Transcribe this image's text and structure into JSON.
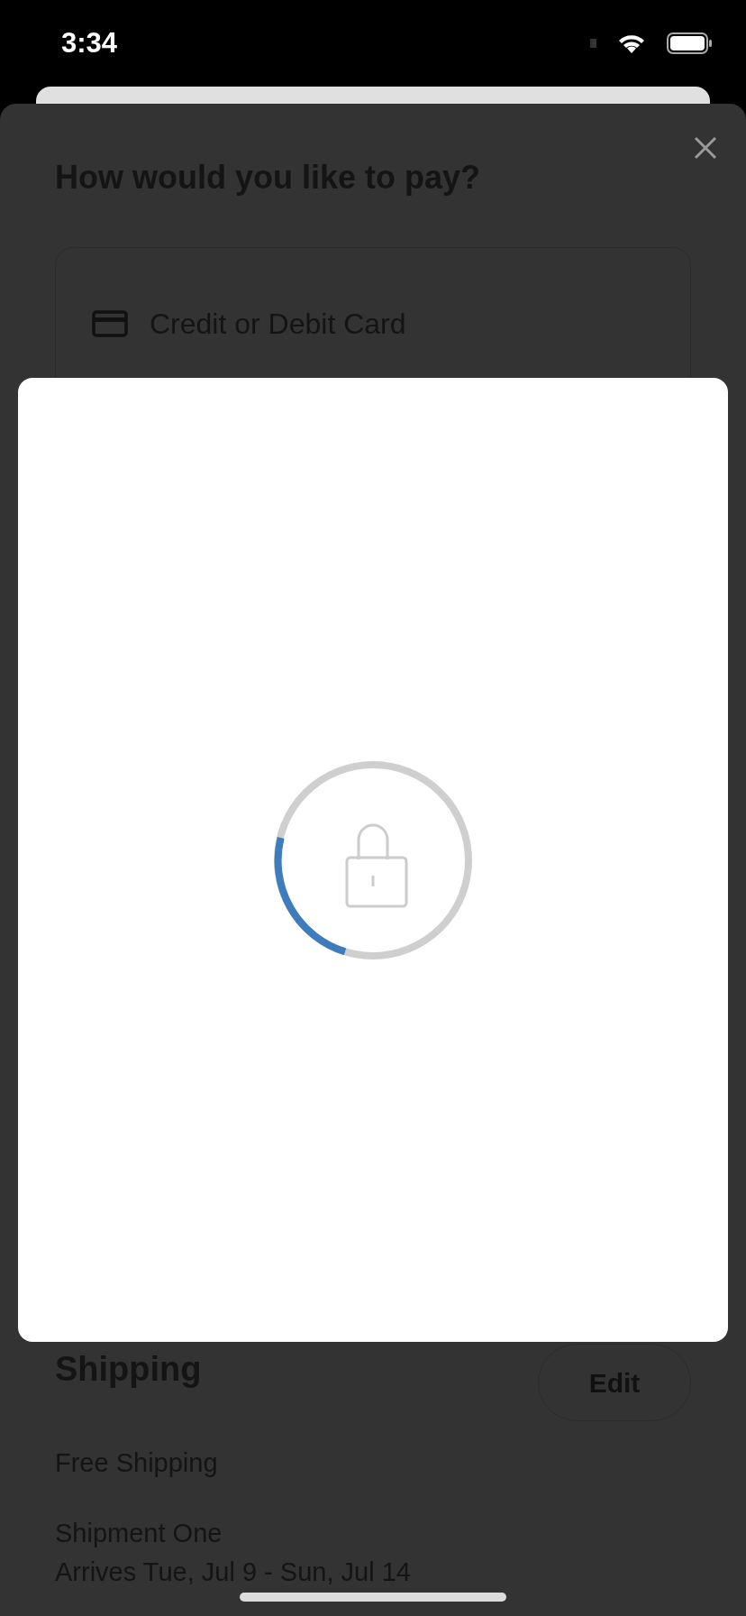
{
  "status_bar": {
    "time": "3:34"
  },
  "sheet": {
    "title": "How would you like to pay?",
    "payment_options": [
      {
        "label": "Credit or Debit Card"
      }
    ],
    "shipping": {
      "heading": "Shipping",
      "edit_button": "Edit",
      "method": "Free Shipping",
      "shipment_title": "Shipment One",
      "arrival": "Arrives Tue, Jul 9 - Sun, Jul 14"
    }
  }
}
